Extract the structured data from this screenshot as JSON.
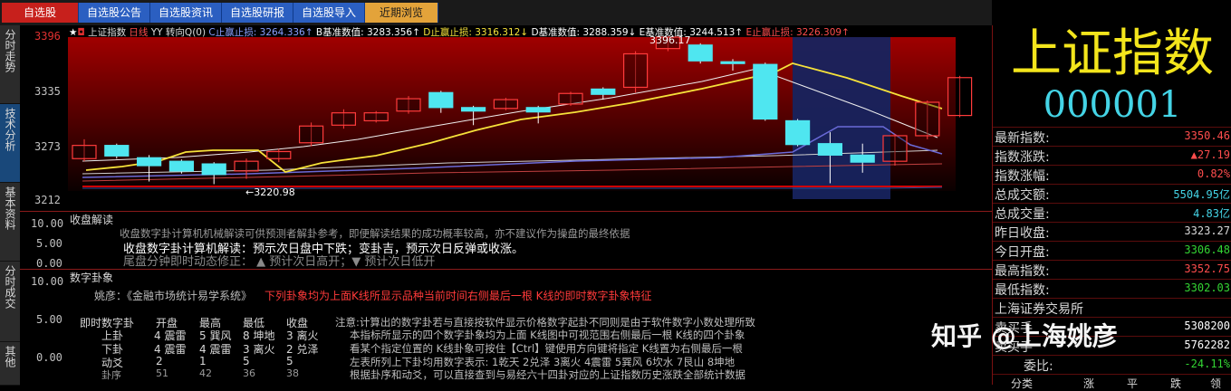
{
  "tabs": [
    "自选股",
    "自选股公告",
    "自选股资讯",
    "自选股研报",
    "自选股导入",
    "近期浏览"
  ],
  "side_tabs": [
    "分时走势",
    "技术分析",
    "基本资料",
    "分时成交",
    "其他"
  ],
  "chart": {
    "index_name": "上证指数",
    "period": "日线",
    "indicator": "YY 转向Q(0)",
    "c_label": "C止赢止损:",
    "c_val": "3264.336↑",
    "b_label": "B基准数值:",
    "b_val": "3283.356↑",
    "d_label": "D止赢止损:",
    "d_val": "3316.312↓",
    "dd_label": "D基准数值:",
    "dd_val": "3288.359↓",
    "e_label": "E基准数值:",
    "e_val": "3244.513↑",
    "ee_label": "E止赢止损:",
    "ee_val": "3226.309↑",
    "yticks": [
      "3396",
      "3335",
      "3273",
      "3212"
    ],
    "high_label": "3396.17",
    "low_label": "←3220.98"
  },
  "chart_data": {
    "type": "candlestick",
    "ylim": [
      3212,
      3396
    ],
    "candles": [
      {
        "o": 3273,
        "c": 3258,
        "h": 3280,
        "l": 3255,
        "up": true
      },
      {
        "o": 3273,
        "c": 3261,
        "h": 3275,
        "l": 3258,
        "up": false
      },
      {
        "o": 3259,
        "c": 3250,
        "h": 3262,
        "l": 3232,
        "up": false
      },
      {
        "o": 3255,
        "c": 3244,
        "h": 3257,
        "l": 3241,
        "up": false
      },
      {
        "o": 3252,
        "c": 3240,
        "h": 3254,
        "l": 3229,
        "up": false
      },
      {
        "o": 3244,
        "c": 3255,
        "h": 3258,
        "l": 3235,
        "up": true
      },
      {
        "o": 3258,
        "c": 3266,
        "h": 3269,
        "l": 3254,
        "up": true
      },
      {
        "o": 3276,
        "c": 3295,
        "h": 3299,
        "l": 3272,
        "up": true
      },
      {
        "o": 3296,
        "c": 3310,
        "h": 3314,
        "l": 3292,
        "up": true
      },
      {
        "o": 3301,
        "c": 3310,
        "h": 3312,
        "l": 3299,
        "up": true
      },
      {
        "o": 3312,
        "c": 3326,
        "h": 3329,
        "l": 3309,
        "up": true
      },
      {
        "o": 3333,
        "c": 3316,
        "h": 3335,
        "l": 3310,
        "up": false
      },
      {
        "o": 3316,
        "c": 3312,
        "h": 3318,
        "l": 3296,
        "up": false
      },
      {
        "o": 3315,
        "c": 3325,
        "h": 3327,
        "l": 3313,
        "up": true
      },
      {
        "o": 3316,
        "c": 3311,
        "h": 3318,
        "l": 3298,
        "up": false
      },
      {
        "o": 3320,
        "c": 3332,
        "h": 3334,
        "l": 3318,
        "up": true
      },
      {
        "o": 3337,
        "c": 3331,
        "h": 3339,
        "l": 3325,
        "up": false
      },
      {
        "o": 3339,
        "c": 3377,
        "h": 3380,
        "l": 3333,
        "up": true
      },
      {
        "o": 3383,
        "c": 3396,
        "h": 3396,
        "l": 3380,
        "up": true
      },
      {
        "o": 3387,
        "c": 3369,
        "h": 3389,
        "l": 3366,
        "up": false
      },
      {
        "o": 3368,
        "c": 3366,
        "h": 3371,
        "l": 3358,
        "up": false
      },
      {
        "o": 3365,
        "c": 3303,
        "h": 3367,
        "l": 3301,
        "up": false
      },
      {
        "o": 3301,
        "c": 3274,
        "h": 3303,
        "l": 3272,
        "up": false
      },
      {
        "o": 3275,
        "c": 3262,
        "h": 3288,
        "l": 3230,
        "up": false
      },
      {
        "o": 3262,
        "c": 3254,
        "h": 3275,
        "l": 3242,
        "up": false
      },
      {
        "o": 3255,
        "c": 3284,
        "h": 3286,
        "l": 3250,
        "up": true
      },
      {
        "o": 3284,
        "c": 3322,
        "h": 3324,
        "l": 3280,
        "up": true
      },
      {
        "o": 3307,
        "c": 3350,
        "h": 3352,
        "l": 3305,
        "up": true
      }
    ]
  },
  "pane1": {
    "yticks": [
      "10.00",
      "5.00",
      "0.00"
    ],
    "title": "收盘解读",
    "line1": "收盘数字卦计算机机械解读可供预测者解卦参考，即便解读结果的成功概率较高，亦不建议作为操盘的最终依据",
    "line2": "收盘数字卦计算机解读：预示次日盘中下跌；变卦吉，预示次日反弹或收涨。",
    "line3": "尾盘分钟即时动态修正：  ▲ 预计次日高开；▼ 预计次日低开"
  },
  "pane2": {
    "yticks": [
      "10.00",
      "5.00",
      "0.00"
    ],
    "title": "数字卦象",
    "source": "姚彦：《金融市场统计易学系统》",
    "note_red": "下列卦象均为上面K线所显示品种当前时间右侧最后一根 K线的即时数字卦象特征",
    "table_headers": [
      "即时数字卦",
      "开盘",
      "最高",
      "最低",
      "收盘"
    ],
    "table_rows": [
      [
        "上卦",
        "4 震雷",
        "5 巽风",
        "8 坤地",
        "3 离火"
      ],
      [
        "下卦",
        "4 震雷",
        "4 震雷",
        "3 离火",
        "2 兑泽"
      ],
      [
        "动爻",
        "2",
        "1",
        "5",
        "5"
      ],
      [
        "卦序",
        "51",
        "42",
        "36",
        "38"
      ]
    ],
    "notes": [
      "注意:计算出的数字卦若与直接按软件显示价格数字起卦不同则是由于软件数字小数处理所致",
      "本指标所显示的四个数字卦象均为上面 K线图中可视范围右侧最后一根 K线的四个卦象",
      "看某个指定位置的 K线卦象可按住【Ctrl】键使用方向键将指定 K线置为右侧最后一根",
      "左表所列上下卦均用数字表示:  1乾天  2兑泽  3离火  4震雷  5巽风  6坎水  7艮山  8坤地",
      "根据卦序和动爻，可以直接查到与易经六十四卦对应的上证指数历史涨跌全部统计数据"
    ]
  },
  "right": {
    "name": "上证指数",
    "code": "000001",
    "rows": [
      {
        "k": "最新指数:",
        "v": "3350.46",
        "c": "#ff4d4d"
      },
      {
        "k": "指数涨跌:",
        "v": "▲27.19",
        "c": "#ff4d4d"
      },
      {
        "k": "指数涨幅:",
        "v": "0.82%",
        "c": "#ff4d4d"
      },
      {
        "k": "总成交额:",
        "v": "5504.95亿",
        "c": "#44d4e6"
      },
      {
        "k": "总成交量:",
        "v": "4.83亿",
        "c": "#44d4e6"
      },
      {
        "k": "昨日收盘:",
        "v": "3323.27",
        "c": "#d8d8d8"
      },
      {
        "k": "今日开盘:",
        "v": "3306.48",
        "c": "#33d433"
      },
      {
        "k": "最高指数:",
        "v": "3352.75",
        "c": "#ff4d4d"
      },
      {
        "k": "最低指数:",
        "v": "3302.03",
        "c": "#33d433"
      }
    ],
    "exchange": "上海证券交易所",
    "r1_k": "卖买手",
    "r1_v": "5308200",
    "r2_k": "卖买手",
    "r2_v": "5762282",
    "r3_k": "委比:",
    "r3_v": "-24.11%",
    "bottom": [
      "分类",
      "涨",
      "平",
      "跌",
      "领"
    ]
  },
  "watermark": "知乎 @上海姚彦"
}
